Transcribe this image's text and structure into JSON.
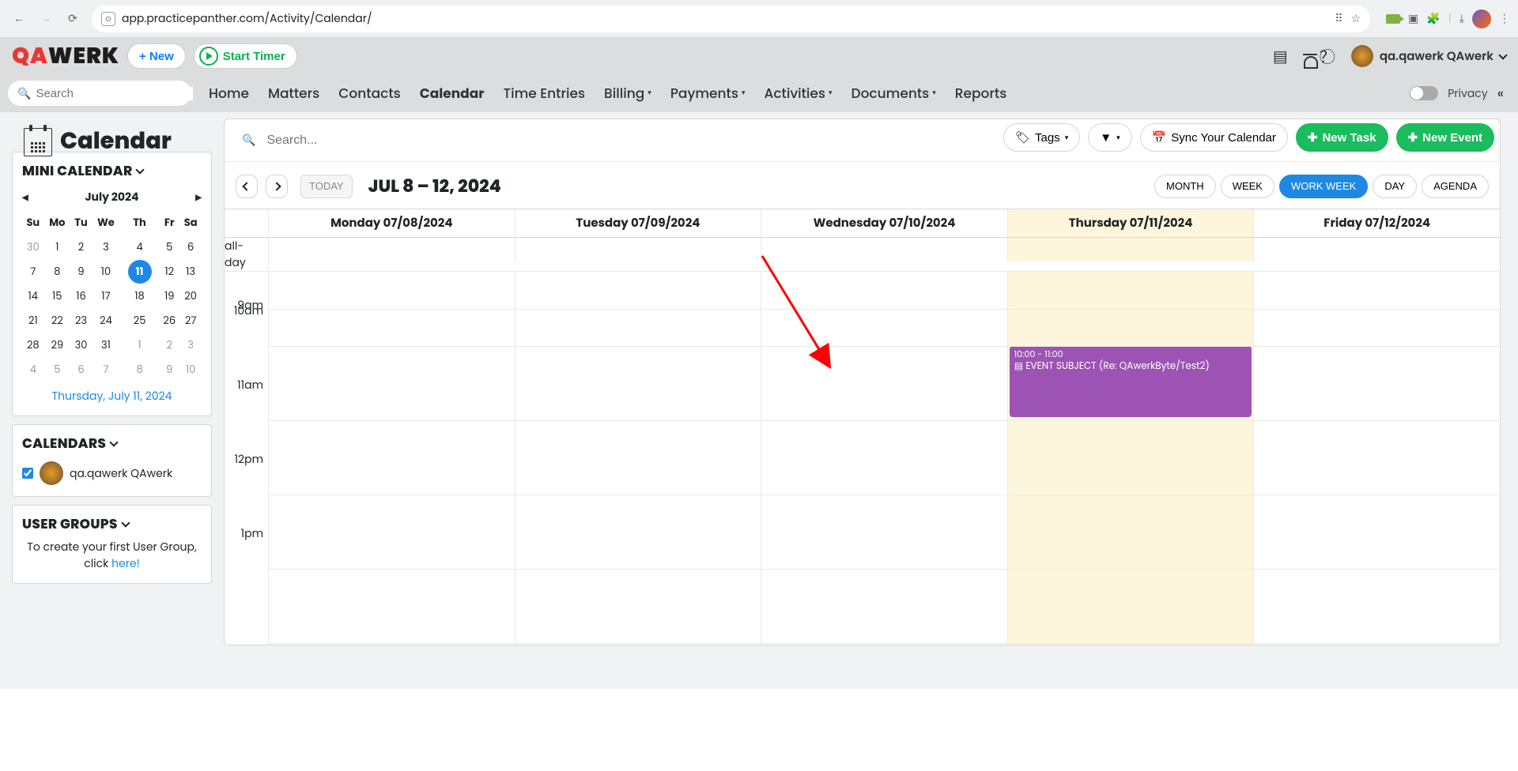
{
  "browser": {
    "url": "app.practicepanther.com/Activity/Calendar/"
  },
  "app": {
    "logo_left": "QA",
    "logo_right": "WERK",
    "new_btn": "+ New",
    "timer_btn": "Start Timer",
    "user_name": "qa.qawerk QAwerk",
    "privacy_label": "Privacy",
    "search_placeholder": "Search",
    "nav": [
      "Home",
      "Matters",
      "Contacts",
      "Calendar",
      "Time Entries",
      "Billing",
      "Payments",
      "Activities",
      "Documents",
      "Reports"
    ]
  },
  "page": {
    "title": "Calendar",
    "tags_btn": "Tags",
    "sync_btn": "Sync Your Calendar",
    "new_task": "New Task",
    "new_event": "New Event",
    "search_placeholder": "Search..."
  },
  "toolbar": {
    "today": "TODAY",
    "range": "JUL 8 – 12, 2024",
    "views": [
      "MONTH",
      "WEEK",
      "WORK WEEK",
      "DAY",
      "AGENDA"
    ],
    "active_view": "WORK WEEK"
  },
  "days": [
    "Monday 07/08/2024",
    "Tuesday 07/09/2024",
    "Wednesday 07/10/2024",
    "Thursday 07/11/2024",
    "Friday 07/12/2024"
  ],
  "allday_label": "all-day",
  "hours": [
    "9am",
    "10am",
    "11am",
    "12pm",
    "1pm"
  ],
  "event": {
    "time": "10:00 - 11:00",
    "title": "EVENT SUBJECT (Re: QAwerkByte/Test2)"
  },
  "sidebar": {
    "mini_title": "MINI CALENDAR",
    "month_label": "July 2024",
    "dow": [
      "Su",
      "Mo",
      "Tu",
      "We",
      "Th",
      "Fr",
      "Sa"
    ],
    "today_full": "Thursday, July 11, 2024",
    "cal_title": "CALENDARS",
    "cal_user": "qa.qawerk QAwerk",
    "ug_title": "USER GROUPS",
    "ug_text": "To create your first User Group, click ",
    "ug_link": "here!"
  },
  "mini_days": [
    [
      "30",
      "1",
      "2",
      "3",
      "4",
      "5",
      "6"
    ],
    [
      "7",
      "8",
      "9",
      "10",
      "11",
      "12",
      "13"
    ],
    [
      "14",
      "15",
      "16",
      "17",
      "18",
      "19",
      "20"
    ],
    [
      "21",
      "22",
      "23",
      "24",
      "25",
      "26",
      "27"
    ],
    [
      "28",
      "29",
      "30",
      "31",
      "1",
      "2",
      "3"
    ],
    [
      "4",
      "5",
      "6",
      "7",
      "8",
      "9",
      "10"
    ]
  ]
}
